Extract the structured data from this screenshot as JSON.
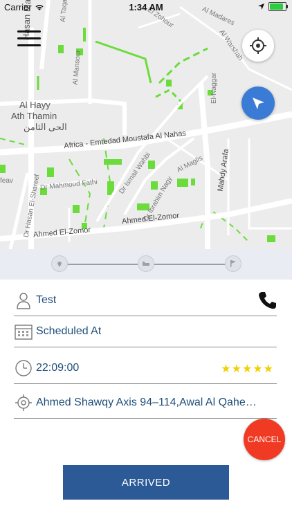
{
  "status_bar": {
    "carrier": "Carrier",
    "time": "1:34 AM",
    "battery_level": 0.95
  },
  "map": {
    "labels": {
      "al_hayy": "Al Hayy",
      "ath_thamin": "Ath Thamin",
      "arabic": "الحى الثامن",
      "hasan_mamoun": "Hasan Mamoun",
      "africa_road": "Africa - Emtedad Moustafa Al Nahas",
      "el_nagar": "El-Naggar",
      "el_zohour": "El Zohour",
      "al_madares": "Al Madares",
      "al_warshah": "Al Warshah",
      "al_maglis": "Al Maglis",
      "dr_ismail_wahbi": "Dr Ismail Wahbi",
      "dr_ibrahim_nagy": "Dr Ibrahim Nagy",
      "dr_mahmoud_fathi": "Dr Mahmoud Fathi",
      "dr_hasan_el_shareef": "Dr Hasan El-Shareef",
      "mahdy_arafa": "Mahdy Arafa",
      "ahmed_el_zomor_1": "Ahmed El-Zomor",
      "ahmed_el_zomor_2": "Ahmed El-Zomor",
      "al_taqa": "Al Taqa",
      "al_mansour": "Al Mansour",
      "feav": "feav"
    },
    "icons": {
      "menu": "hamburger-menu-icon",
      "locate": "crosshair-icon",
      "navigate": "navigation-arrow-icon"
    }
  },
  "progress": {
    "steps": [
      "location-pin-icon",
      "bed-icon",
      "flag-icon"
    ]
  },
  "details": {
    "name": "Test",
    "scheduled_label": "Scheduled At",
    "time": "22:09:00",
    "rating_stars": 5,
    "stars_text": "★★★★★",
    "address": "Ahmed Shawqy Axis 94–114,Awal Al Qahe…"
  },
  "actions": {
    "cancel": "CANCEL",
    "arrived": "ARRIVED"
  },
  "colors": {
    "accent_blue": "#2c5a96",
    "text_blue": "#1f4e7a",
    "cancel_red": "#f03a24",
    "star_yellow": "#f2d100",
    "park_green": "#6bdc3c",
    "nav_blue": "#3a7bd5"
  }
}
